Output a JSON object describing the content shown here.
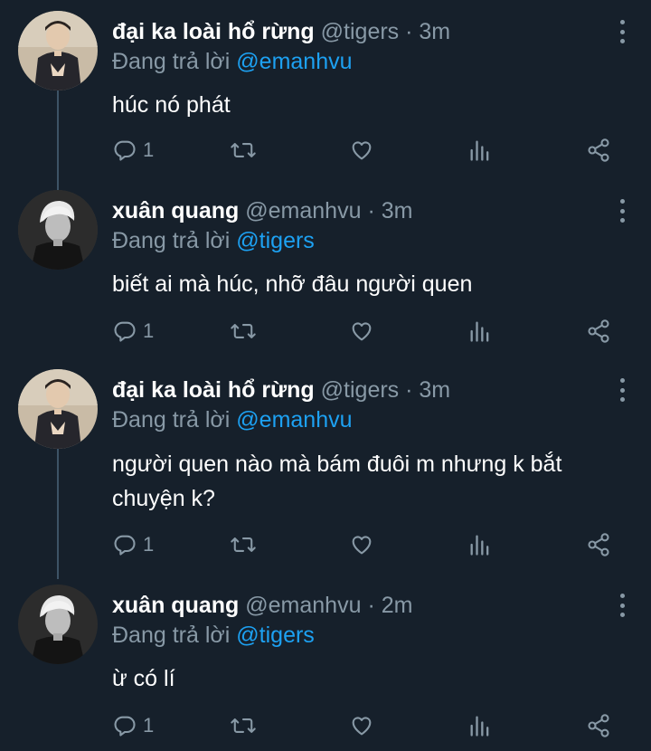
{
  "tweets": [
    {
      "name": "đại ka loài hổ rừng",
      "handle": "@tigers",
      "separator": "·",
      "time": "3m",
      "reply_prefix": "Đang trả lời",
      "reply_to": "@emanhvu",
      "text": "húc nó phát",
      "reply_count": "1",
      "avatar": "avatar-tigers"
    },
    {
      "name": "xuân quang",
      "handle": "@emanhvu",
      "separator": "·",
      "time": "3m",
      "reply_prefix": "Đang trả lời",
      "reply_to": "@tigers",
      "text": "biết ai mà húc, nhỡ đâu người quen",
      "reply_count": "1",
      "avatar": "avatar-emanhvu"
    },
    {
      "name": "đại ka loài hổ rừng",
      "handle": "@tigers",
      "separator": "·",
      "time": "3m",
      "reply_prefix": "Đang trả lời",
      "reply_to": "@emanhvu",
      "text": "người quen nào mà bám đuôi m nhưng k bắt chuyện k?",
      "reply_count": "1",
      "avatar": "avatar-tigers"
    },
    {
      "name": "xuân quang",
      "handle": "@emanhvu",
      "separator": "·",
      "time": "2m",
      "reply_prefix": "Đang trả lời",
      "reply_to": "@tigers",
      "text": "ừ có lí",
      "reply_count": "1",
      "avatar": "avatar-emanhvu"
    }
  ],
  "icons": {
    "reply": "reply-icon",
    "retweet": "retweet-icon",
    "like": "heart-icon",
    "analytics": "analytics-icon",
    "share": "share-icon",
    "more": "more-vertical-icon"
  },
  "colors": {
    "background": "#16202b",
    "muted": "#8899a6",
    "accent": "#1da1f2",
    "thread_line": "#3d5366"
  }
}
